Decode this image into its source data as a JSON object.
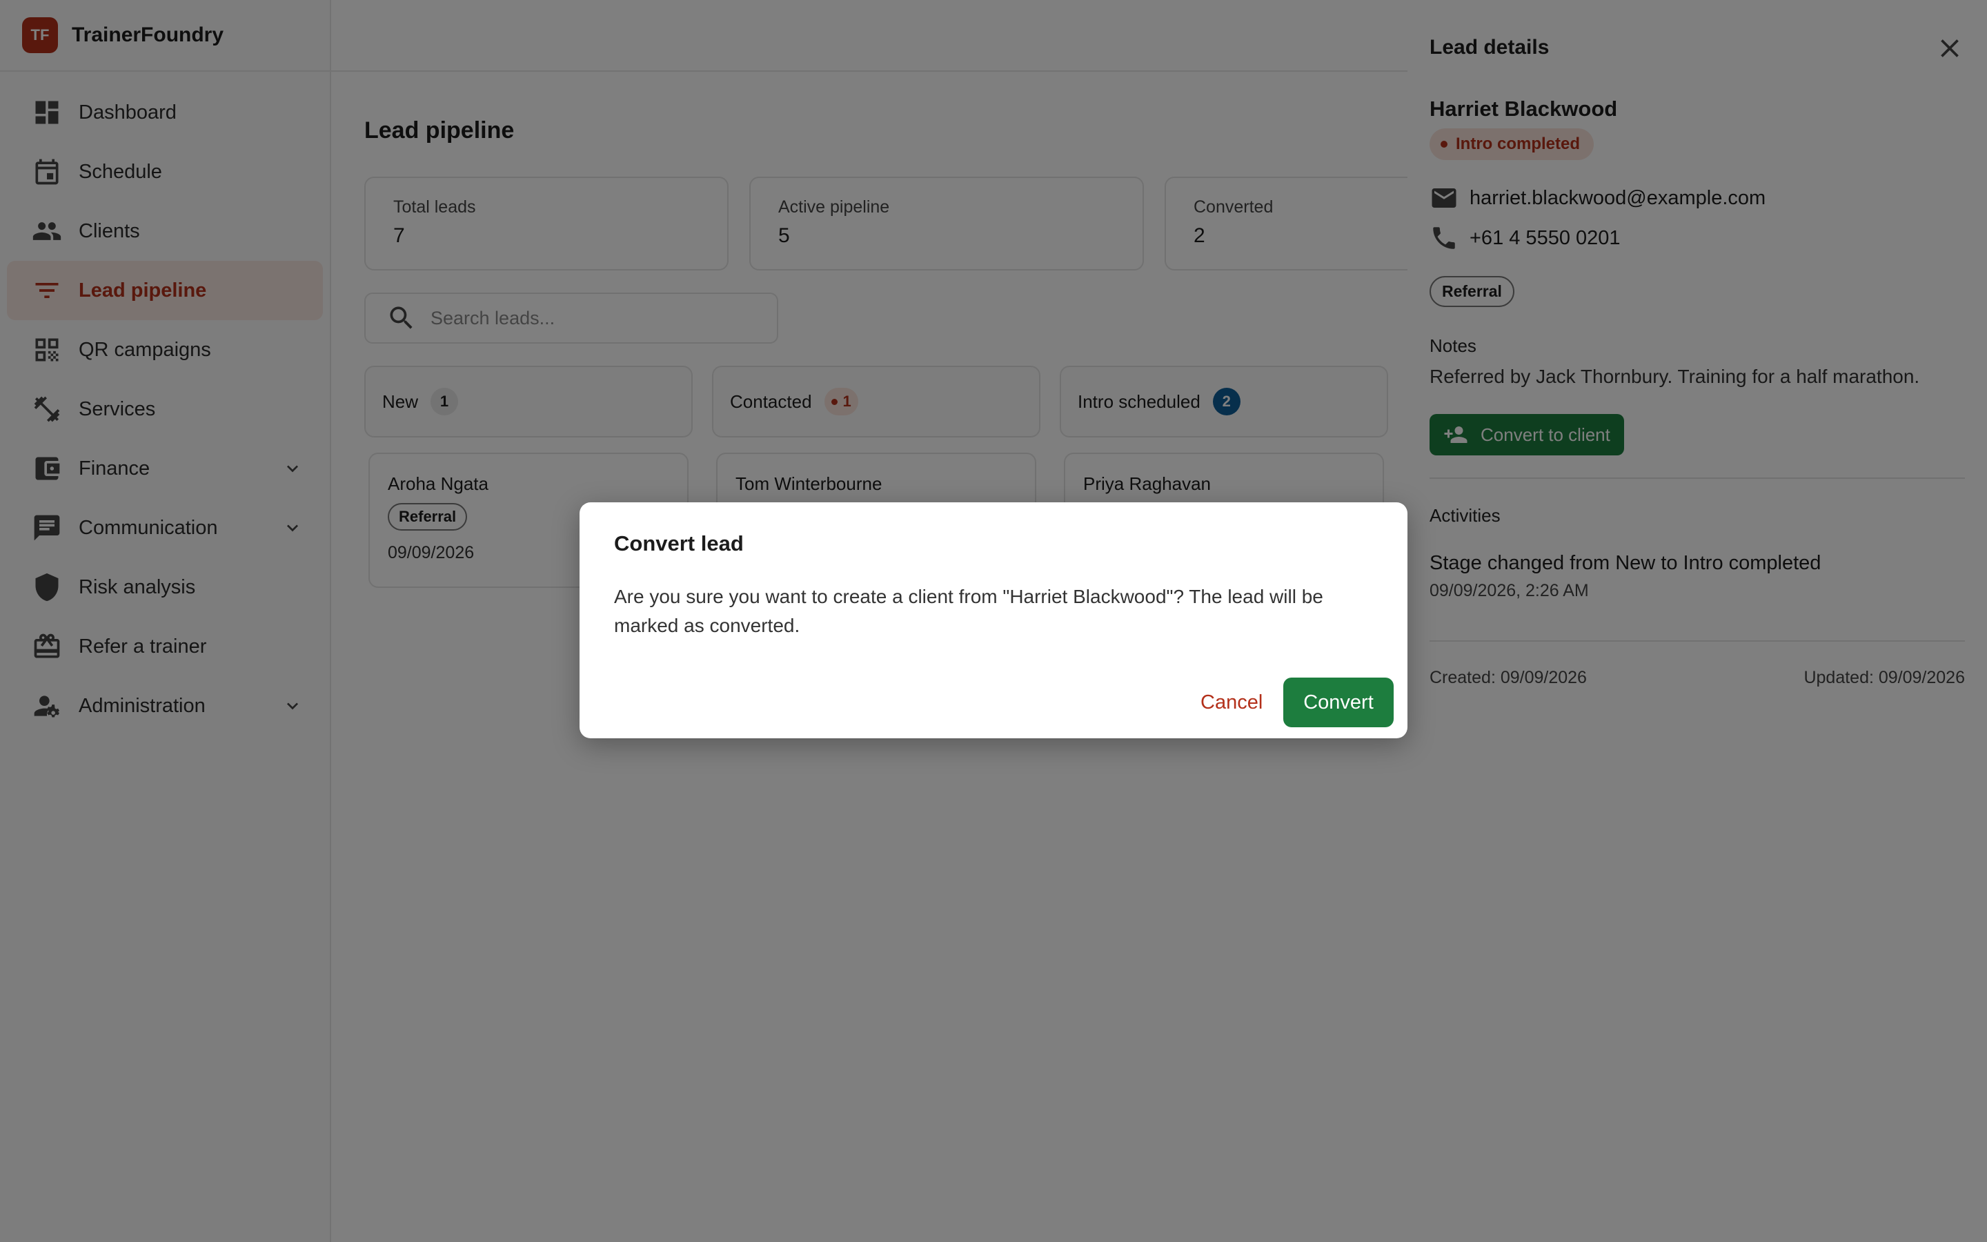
{
  "app": {
    "logo_text": "TF",
    "name": "TrainerFoundry"
  },
  "sidebar": {
    "items": [
      {
        "label": "Dashboard",
        "icon": "dashboard-icon"
      },
      {
        "label": "Schedule",
        "icon": "calendar-icon"
      },
      {
        "label": "Clients",
        "icon": "people-icon"
      },
      {
        "label": "Lead pipeline",
        "icon": "filter-icon",
        "active": true
      },
      {
        "label": "QR campaigns",
        "icon": "qr-code-icon"
      },
      {
        "label": "Services",
        "icon": "dumbbell-icon"
      },
      {
        "label": "Finance",
        "icon": "wallet-icon",
        "expandable": true
      },
      {
        "label": "Communication",
        "icon": "chat-icon",
        "expandable": true
      },
      {
        "label": "Risk analysis",
        "icon": "shield-icon"
      },
      {
        "label": "Refer a trainer",
        "icon": "gift-card-icon"
      },
      {
        "label": "Administration",
        "icon": "user-settings-icon",
        "expandable": true
      }
    ]
  },
  "main": {
    "title": "Lead pipeline",
    "stats": [
      {
        "label": "Total leads",
        "value": "7"
      },
      {
        "label": "Active pipeline",
        "value": "5"
      },
      {
        "label": "Converted",
        "value": "2"
      }
    ],
    "search": {
      "placeholder": "Search leads..."
    },
    "columns": [
      {
        "title": "New",
        "count": "1"
      },
      {
        "title": "Contacted",
        "count": "1"
      },
      {
        "title": "Intro scheduled",
        "count": "2"
      }
    ],
    "cards": [
      {
        "name": "Aroha Ngata",
        "source": "Referral",
        "date": "09/09/2026"
      },
      {
        "name": "Tom Winterbourne"
      },
      {
        "name": "Priya Raghavan"
      }
    ]
  },
  "drawer": {
    "title": "Lead details",
    "name": "Harriet Blackwood",
    "status": "Intro completed",
    "email": "harriet.blackwood@example.com",
    "phone": "+61 4 5550 0201",
    "source": "Referral",
    "notes_label": "Notes",
    "notes": "Referred by Jack Thornbury. Training for a half marathon.",
    "convert_label": "Convert to client",
    "activities_label": "Activities",
    "activity_title": "Stage changed from New to Intro completed",
    "activity_date": "09/09/2026, 2:26 AM",
    "created": "Created: 09/09/2026",
    "updated": "Updated: 09/09/2026"
  },
  "dialog": {
    "title": "Convert lead",
    "body": "Are you sure you want to create a client from \"Harriet Blackwood\"? The lead will be marked as converted.",
    "cancel_label": "Cancel",
    "confirm_label": "Convert"
  },
  "colors": {
    "brand": "#b3301a",
    "success": "#1d7d3e",
    "info": "#0e5e98"
  }
}
